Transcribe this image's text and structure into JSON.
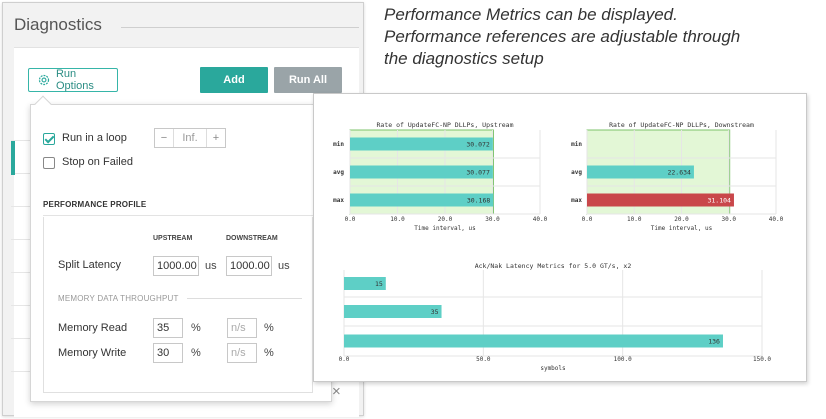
{
  "diagnostics": {
    "title": "Diagnostics",
    "run_options_label": "Run Options",
    "add_label": "Add",
    "run_all_label": "Run All",
    "close_label": "×"
  },
  "run_options": {
    "loop_label": "Run in a loop",
    "loop_checked": true,
    "loop_minus": "−",
    "loop_value": "Inf.",
    "loop_plus": "+",
    "stop_failed_label": "Stop on Failed",
    "stop_failed_checked": false
  },
  "performance_profile": {
    "title": "PERFORMANCE PROFILE",
    "col_upstream": "UPSTREAM",
    "col_downstream": "DOWNSTREAM",
    "split_latency_label": "Split Latency",
    "split_upstream": "1000.00",
    "split_upstream_unit": "us",
    "split_downstream": "1000.00",
    "split_downstream_unit": "us",
    "memory_section": "MEMORY DATA THROUGHPUT",
    "memory_read_label": "Memory Read",
    "memory_read_up": "35",
    "memory_read_up_unit": "%",
    "memory_read_down": "n/s",
    "memory_read_down_unit": "%",
    "memory_write_label": "Memory Write",
    "memory_write_up": "30",
    "memory_write_up_unit": "%",
    "memory_write_down": "n/s",
    "memory_write_down_unit": "%"
  },
  "description": {
    "line1": "Performance Metrics can be displayed.",
    "line2": "Performance references are adjustable through",
    "line3": "the diagnostics setup"
  },
  "colors": {
    "teal": "#2aa89c",
    "bar_teal": "#5ecfc6",
    "bar_red": "#c9474a",
    "zone_green": "#e3f7d6"
  },
  "chart_data": [
    {
      "type": "bar",
      "orientation": "horizontal",
      "title": "Rate of UpdateFC-NP DLLPs, Upstream",
      "xlabel": "Time interval, us",
      "categories": [
        "min",
        "avg",
        "max"
      ],
      "values": [
        30.072,
        30.077,
        30.168
      ],
      "value_labels": [
        "30.072",
        "30.077",
        "30.168"
      ],
      "xlim": [
        0,
        40
      ],
      "x_ticks": [
        "0.0",
        "10.0",
        "20.0",
        "30.0",
        "40.0"
      ],
      "reference_zone": [
        0,
        30.2
      ],
      "grid": true
    },
    {
      "type": "bar",
      "orientation": "horizontal",
      "title": "Rate of UpdateFC-NP DLLPs, Downstream",
      "xlabel": "Time interval, us",
      "categories": [
        "min",
        "avg",
        "max"
      ],
      "values": [
        0,
        22.634,
        31.104
      ],
      "value_labels": [
        "",
        "22.634",
        "31.104"
      ],
      "xlim": [
        0,
        40
      ],
      "x_ticks": [
        "0.0",
        "10.0",
        "20.0",
        "30.0",
        "40.0"
      ],
      "reference_zone": [
        0,
        30.2
      ],
      "grid": true
    },
    {
      "type": "bar",
      "orientation": "horizontal",
      "title": "Ack/Nak Latency Metrics for 5.0 GT/s, x2",
      "xlabel": "symbols",
      "categories": [
        "",
        "",
        ""
      ],
      "values": [
        15,
        35,
        136
      ],
      "value_labels": [
        "15",
        "35",
        "136"
      ],
      "xlim": [
        0,
        150
      ],
      "x_ticks": [
        "0.0",
        "50.0",
        "100.0",
        "150.0"
      ],
      "grid": true
    }
  ]
}
